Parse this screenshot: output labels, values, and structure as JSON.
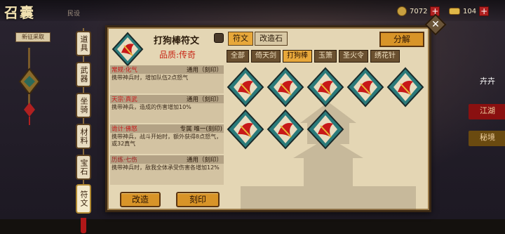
{
  "app": {
    "title": "召囊",
    "top_sub": "民设",
    "stamp_text": "新征采取"
  },
  "currency": {
    "coin_value": "7072",
    "gold_value": "104",
    "plus": "+"
  },
  "right_deco": {
    "item1": "卉卉",
    "item2": "江湖",
    "item3": "秘境"
  },
  "side_tabs": [
    {
      "label": "道具"
    },
    {
      "label": "武器"
    },
    {
      "label": "坐骑"
    },
    {
      "label": "材料"
    },
    {
      "label": "宝石"
    },
    {
      "label": "符文"
    }
  ],
  "item": {
    "title": "打狗棒符文",
    "quality": "品质:传奇"
  },
  "effects": [
    {
      "name": "常规·化气",
      "tag": "通用（刻印）",
      "desc": "携带神兵时，增加队伍2点怒气"
    },
    {
      "name": "天宗·真武",
      "tag": "通用（刻印）",
      "desc": "携带神兵，造成的伤害增加10%"
    },
    {
      "name": "诡计·佛怒",
      "tag": "专属 唯一(刻印)",
      "desc": "携带神兵，战斗开始时，额外获得8点怒气，或32真气"
    },
    {
      "name": "历练·七伤",
      "tag": "通用（刻印）",
      "desc": "携带神兵时，敌我全体承受伤害各增加12%"
    }
  ],
  "buttons": {
    "reforge": "改造",
    "engrave": "刻印",
    "decompose": "分解"
  },
  "top_tabs": [
    {
      "label": "符文"
    },
    {
      "label": "改造石"
    }
  ],
  "filter_tabs": [
    {
      "label": "全部"
    },
    {
      "label": "倚天剑"
    },
    {
      "label": "打狗棒"
    },
    {
      "label": "玉箫"
    },
    {
      "label": "圣火令"
    },
    {
      "label": "绣花针"
    }
  ],
  "colors": {
    "panel_bg": "#e4d6b4",
    "accent_orange": "#d89428",
    "quality_red": "#c82818"
  },
  "slot_icon": "dog-staff-rune-icon"
}
